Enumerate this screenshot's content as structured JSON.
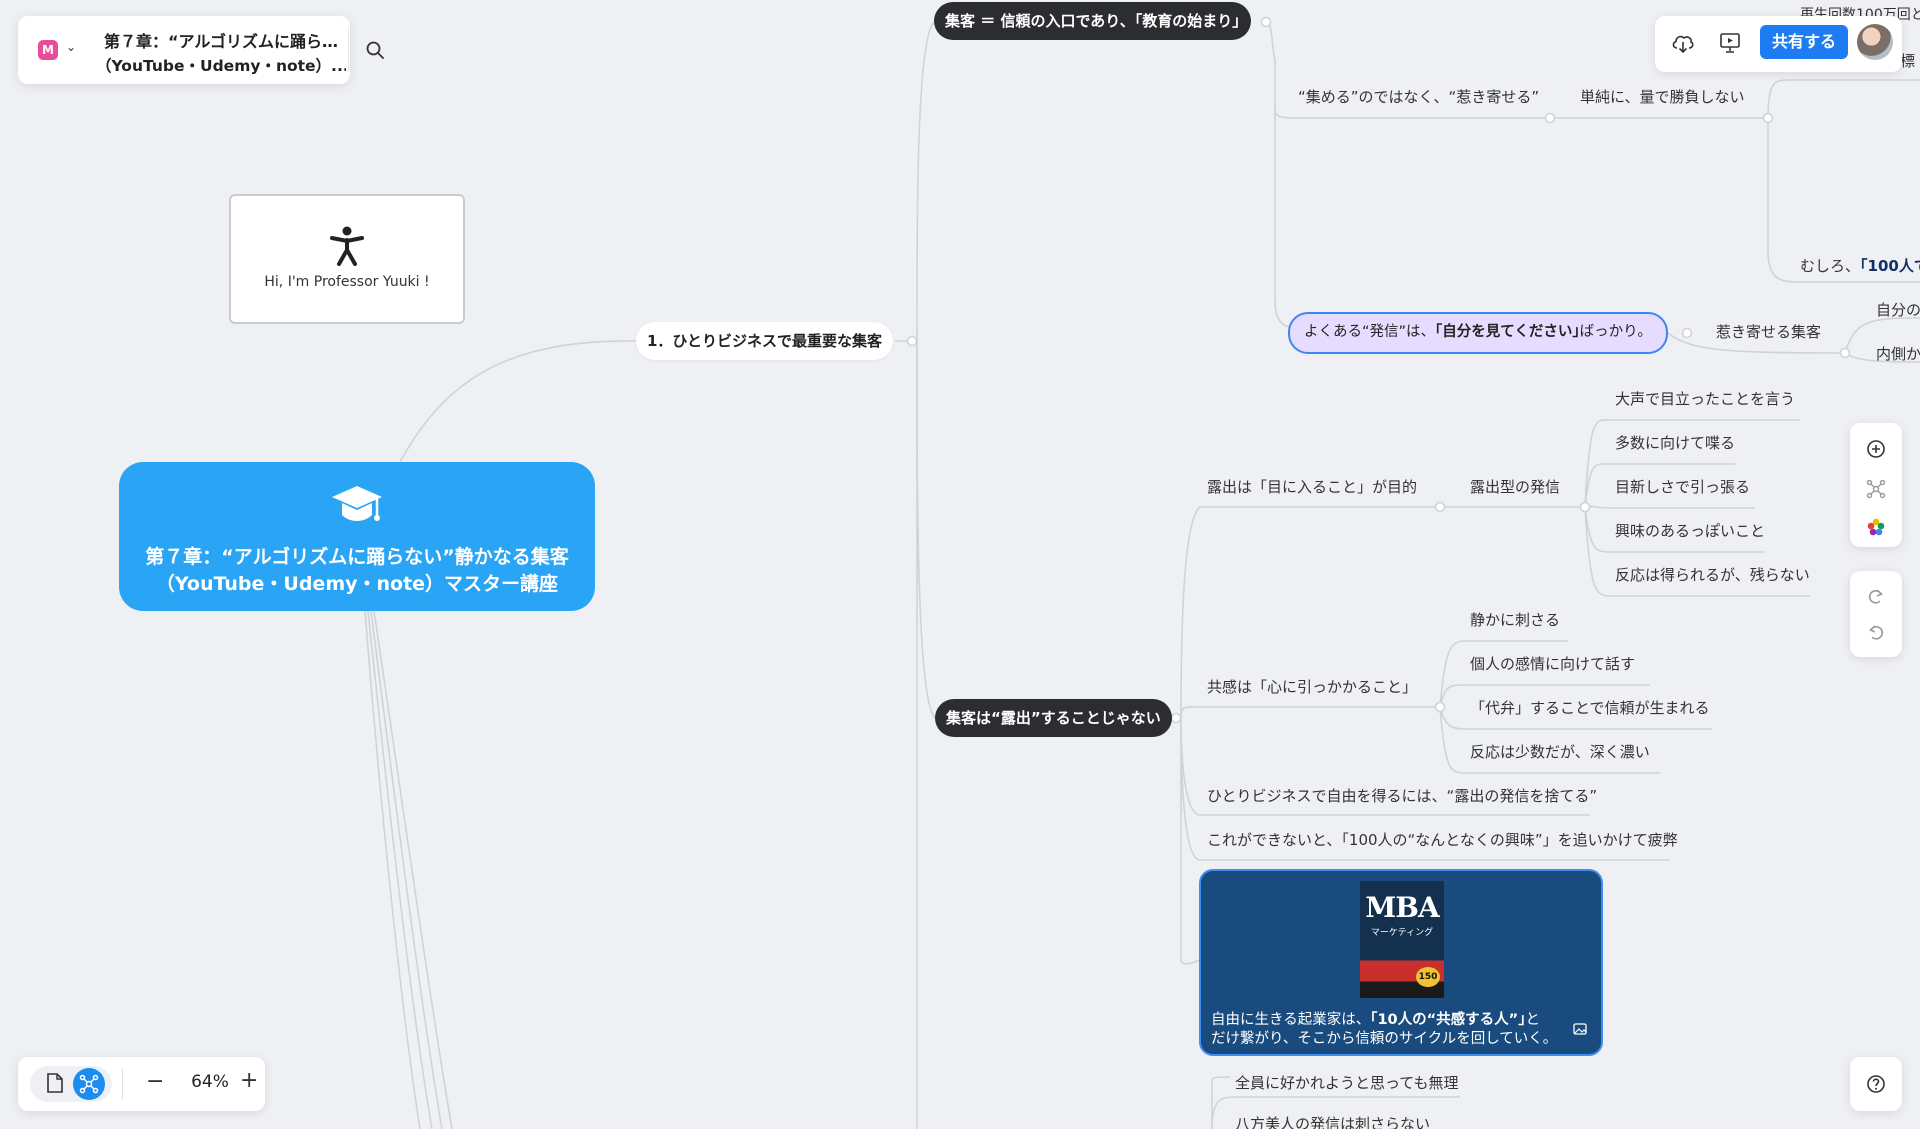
{
  "app": {
    "logo": "M",
    "title_line1": "第７章：“アルゴリズムに踊ら…",
    "title_line2": "（YouTube・Udemy・note）...",
    "share_label": "共有する",
    "zoom": "64%",
    "colors": {
      "accent": "#1d7cf2",
      "root": "#2aa4f4",
      "dark_node": "#2b2d31",
      "highlight": "#e6dcff",
      "image_card": "#1a4b7f"
    }
  },
  "icons": {
    "toolbar": [
      "search-icon",
      "cloud-download-icon",
      "present-icon"
    ],
    "sidebar": [
      "add-circle-icon",
      "mindmap-icon",
      "color-palette-icon",
      "redo-icon",
      "undo-icon"
    ],
    "bottom": [
      "page-view-icon",
      "mindmap-view-icon",
      "zoom-out-icon",
      "zoom-in-icon",
      "help-icon"
    ]
  },
  "mindmap": {
    "root": {
      "line1": "第７章：“アルゴリズムに踊らない”静かなる集客",
      "line2": "（YouTube・Udemy・note）マスター講座"
    },
    "professor_card": "Hi, I'm  Professor  Yuuki !",
    "branch1": "1．ひとりビジネスで最重要な集客",
    "topic_a": "集客 ＝ 信頼の入口であり、｢教育の始まり｣",
    "topic_a_children": {
      "pull_not_push": "“集める”のではなく、“惹き寄せる”",
      "not_volume": "単純に、量で勝負しない",
      "truncated_1": "再生回数100万回と",
      "truncated_2": "標",
      "rather_pre": "むしろ、",
      "rather_bold": "「100人で",
      "common_post_pre": "よくある“発信”は、",
      "common_post_bold": "｢自分を見てください｣",
      "common_post_post": "ばっかり。",
      "attract": "惹き寄せる集客",
      "self_trunc": "自分の",
      "inner_trunc": "内側か"
    },
    "topic_b": "集客は“露出”することじゃない",
    "exposure": {
      "label": "露出は「目に入ること」が目的",
      "type": "露出型の発信",
      "items": [
        "大声で目立ったことを言う",
        "多数に向けて喋る",
        "目新しさで引っ張る",
        "興味のあるっぽいこと",
        "反応は得られるが、残らない"
      ]
    },
    "empathy": {
      "label": "共感は「心に引っかかること」",
      "items": [
        "静かに刺さる",
        "個人の感情に向けて話す",
        "「代弁」することで信頼が生まれる",
        "反応は少数だが、深く濃い"
      ]
    },
    "free_line": "ひとりビジネスで自由を得るには、“露出の発信を捨てる”",
    "tired_line": "これができないと、「100人の“なんとなくの興味”」を追いかけて疲弊",
    "image_card": {
      "book_title": "MBA",
      "book_subtitle": "マーケティング",
      "book_badge": "150",
      "cap1_pre": "自由に生きる起業家は、",
      "cap1_bold": "｢10人の“共感する人”｣",
      "cap1_post": "と",
      "cap2": "だけ繋がり、そこから信頼のサイクルを回していく。"
    },
    "bottom_items": [
      "全員に好かれようと思っても無理",
      "八方美人の発信は刺さらない"
    ]
  }
}
